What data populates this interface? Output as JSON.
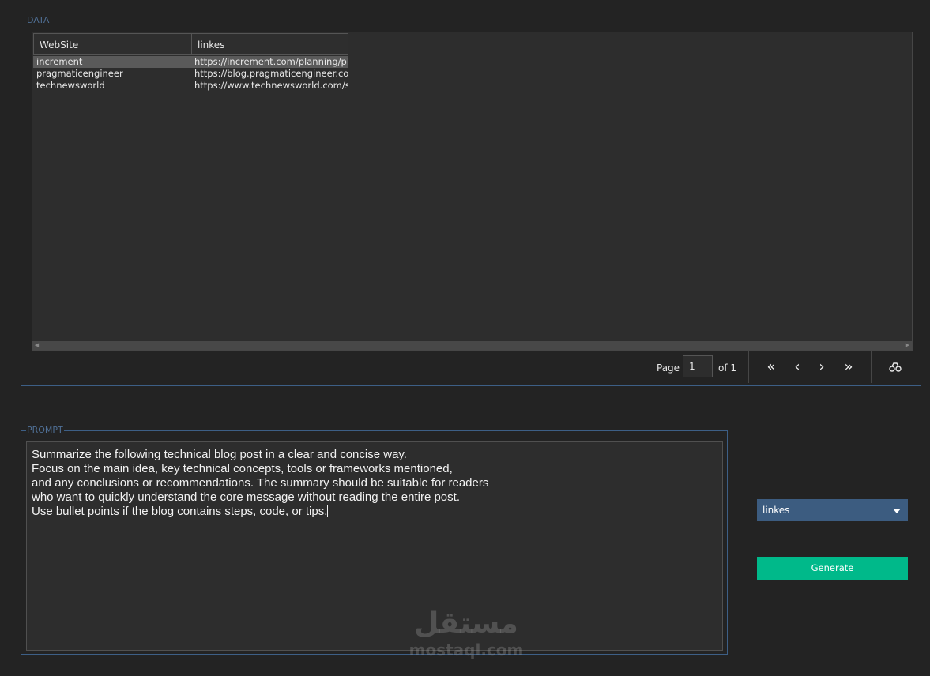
{
  "data_group": {
    "title": "DATA"
  },
  "grid": {
    "columns": [
      "WebSite",
      "linkes"
    ],
    "rows": [
      {
        "website": "increment",
        "link": "https://increment.com/planning/pla",
        "selected": true
      },
      {
        "website": "pragmaticengineer",
        "link": "https://blog.pragmaticengineer.com",
        "selected": false
      },
      {
        "website": "technewsworld",
        "link": "https://www.technewsworld.com/st",
        "selected": false
      }
    ]
  },
  "pager": {
    "page_label": "Page",
    "page_value": "1",
    "of_label": "of 1",
    "first_icon": "first-page-icon",
    "prev_icon": "prev-page-icon",
    "next_icon": "next-page-icon",
    "last_icon": "last-page-icon",
    "search_icon": "binoculars-icon"
  },
  "prompt_group": {
    "title": "PROMPT",
    "lines": [
      "Summarize the following technical blog post in a clear and concise way.",
      "Focus on the main idea, key technical concepts, tools or frameworks mentioned,",
      "and any conclusions or recommendations. The summary should be suitable for readers",
      "who want to quickly understand the core message without reading the entire post.",
      "Use bullet points if the blog contains steps, code, or tips."
    ]
  },
  "combo": {
    "selected": "linkes"
  },
  "generate_button": {
    "label": "Generate"
  },
  "watermark": {
    "arabic": "مستقل",
    "latin": "mostaql.com"
  },
  "colors": {
    "background": "#232323",
    "group_border": "#3d5f86",
    "combo_bg": "#3c5c80",
    "generate_bg": "#00b98a"
  }
}
